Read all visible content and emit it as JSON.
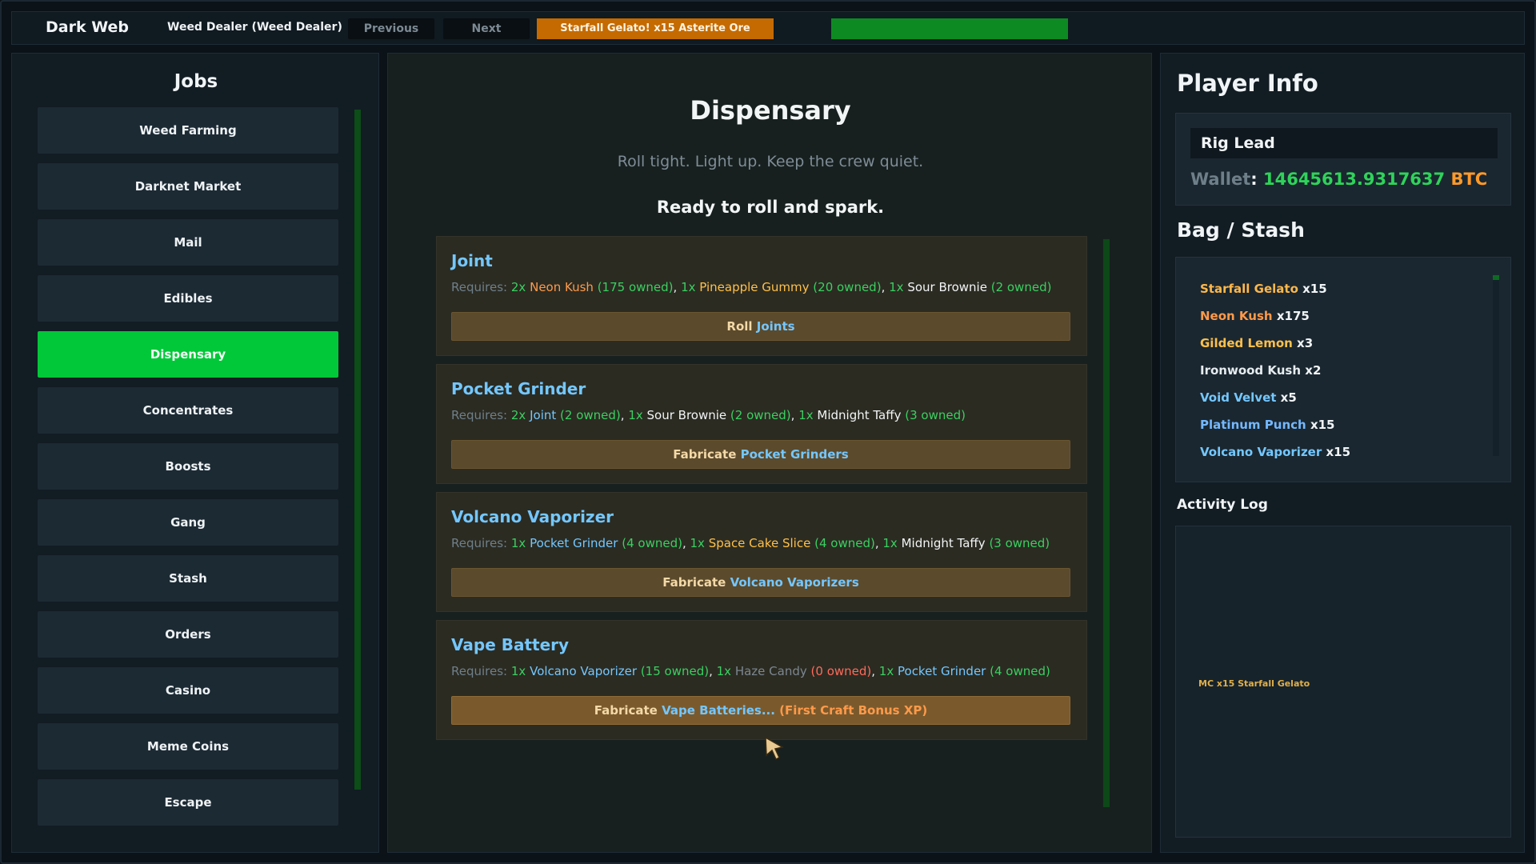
{
  "topbar": {
    "brand": "Dark Web",
    "dealer": "Weed Dealer (Weed Dealer)",
    "previous": "Previous",
    "next": "Next",
    "banner": "Starfall Gelato! x15 Asterite Ore",
    "banner_color": "#c46a00",
    "progress_percent": 100
  },
  "jobs": {
    "title": "Jobs",
    "items": [
      {
        "label": "Weed Farming",
        "active": false
      },
      {
        "label": "Darknet Market",
        "active": false
      },
      {
        "label": "Mail",
        "active": false
      },
      {
        "label": "Edibles",
        "active": false
      },
      {
        "label": "Dispensary",
        "active": true
      },
      {
        "label": "Concentrates",
        "active": false
      },
      {
        "label": "Boosts",
        "active": false
      },
      {
        "label": "Gang",
        "active": false
      },
      {
        "label": "Stash",
        "active": false
      },
      {
        "label": "Orders",
        "active": false
      },
      {
        "label": "Casino",
        "active": false
      },
      {
        "label": "Meme Coins",
        "active": false
      },
      {
        "label": "Escape",
        "active": false
      }
    ],
    "active_color": "#00c838"
  },
  "dispensary": {
    "title": "Dispensary",
    "subtitle": "Roll tight. Light up. Keep the crew quiet.",
    "status": "Ready to roll and spark.",
    "requires_label": "Requires:",
    "recipes": [
      {
        "name": "Joint",
        "requirements": [
          {
            "qty": "2x",
            "item": "Neon Kush",
            "owned": "(175 owned)",
            "item_color": "orange",
            "owned_ok": true
          },
          {
            "qty": "1x",
            "item": "Pineapple Gummy",
            "owned": "(20 owned)",
            "item_color": "gold",
            "owned_ok": true
          },
          {
            "qty": "1x",
            "item": "Sour Brownie",
            "owned": "(2 owned)",
            "item_color": "white",
            "owned_ok": true
          }
        ],
        "action_verb": "Roll",
        "action_target": "Joints",
        "action_suffix": "",
        "highlight": false
      },
      {
        "name": "Pocket Grinder",
        "requirements": [
          {
            "qty": "2x",
            "item": "Joint",
            "owned": "(2 owned)",
            "item_color": "blue",
            "owned_ok": true
          },
          {
            "qty": "1x",
            "item": "Sour Brownie",
            "owned": "(2 owned)",
            "item_color": "white",
            "owned_ok": true
          },
          {
            "qty": "1x",
            "item": "Midnight Taffy",
            "owned": "(3 owned)",
            "item_color": "white",
            "owned_ok": true
          }
        ],
        "action_verb": "Fabricate",
        "action_target": "Pocket Grinders",
        "action_suffix": "",
        "highlight": false
      },
      {
        "name": "Volcano Vaporizer",
        "requirements": [
          {
            "qty": "1x",
            "item": "Pocket Grinder",
            "owned": "(4 owned)",
            "item_color": "blue",
            "owned_ok": true
          },
          {
            "qty": "1x",
            "item": "Space Cake Slice",
            "owned": "(4 owned)",
            "item_color": "gold",
            "owned_ok": true
          },
          {
            "qty": "1x",
            "item": "Midnight Taffy",
            "owned": "(3 owned)",
            "item_color": "white",
            "owned_ok": true
          }
        ],
        "action_verb": "Fabricate",
        "action_target": "Volcano Vaporizers",
        "action_suffix": "",
        "highlight": false
      },
      {
        "name": "Vape Battery",
        "requirements": [
          {
            "qty": "1x",
            "item": "Volcano Vaporizer",
            "owned": "(15 owned)",
            "item_color": "blue",
            "owned_ok": true
          },
          {
            "qty": "1x",
            "item": "Haze Candy",
            "owned": "(0 owned)",
            "item_color": "grey",
            "owned_ok": false
          },
          {
            "qty": "1x",
            "item": "Pocket Grinder",
            "owned": "(4 owned)",
            "item_color": "blue",
            "owned_ok": true
          }
        ],
        "action_verb": "Fabricate",
        "action_target": "Vape Batteries...",
        "action_suffix": " (First Craft Bonus XP)",
        "highlight": true
      }
    ]
  },
  "player": {
    "title": "Player Info",
    "role": "Rig Lead",
    "wallet_label": "Wallet",
    "wallet_amount": "14645613.9317637",
    "wallet_currency": "BTC"
  },
  "bag": {
    "title": "Bag / Stash",
    "items": [
      {
        "name": "Starfall Gelato",
        "count": "x15",
        "color": "#ffb84a"
      },
      {
        "name": "Neon Kush",
        "count": "x175",
        "color": "#ff9a4a"
      },
      {
        "name": "Gilded Lemon",
        "count": "x3",
        "color": "#ffc04a"
      },
      {
        "name": "Ironwood Kush",
        "count": "x2",
        "color": "#e6ecef"
      },
      {
        "name": "Void Velvet",
        "count": "x5",
        "color": "#74c7ff"
      },
      {
        "name": "Platinum Punch",
        "count": "x15",
        "color": "#74b8ff"
      },
      {
        "name": "Volcano Vaporizer",
        "count": "x15",
        "color": "#74c7ff"
      }
    ]
  },
  "log": {
    "title": "Activity Log",
    "entries": [
      "MC x15 Starfall Gelato"
    ]
  }
}
